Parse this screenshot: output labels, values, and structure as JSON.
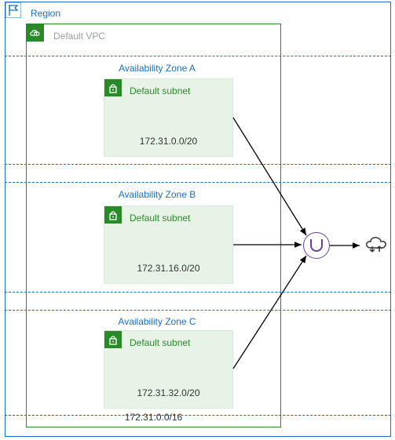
{
  "region": {
    "label": "Region"
  },
  "vpc": {
    "label": "Default VPC",
    "cidr": "172.31.0.0/16"
  },
  "azs": [
    {
      "label": "Availability Zone A",
      "subnet_label": "Default subnet",
      "cidr": "172.31.0.0/20"
    },
    {
      "label": "Availability Zone B",
      "subnet_label": "Default subnet",
      "cidr": "172.31.16.0/20"
    },
    {
      "label": "Availability Zone C",
      "subnet_label": "Default subnet",
      "cidr": "172.31.32.0/20"
    }
  ]
}
